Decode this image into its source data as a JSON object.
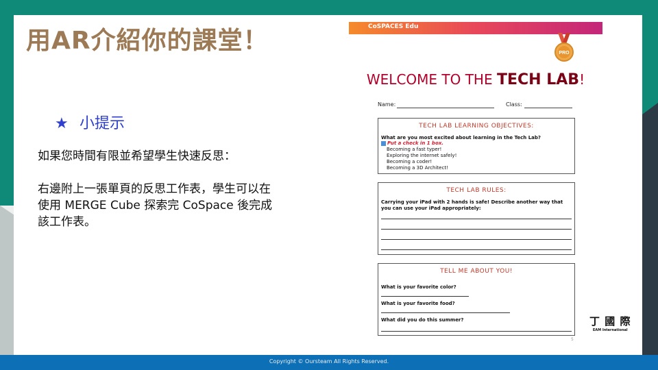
{
  "slide": {
    "title": "用AR介紹你的課堂！",
    "tip_label": "小提示",
    "tip_icon": "star-icon",
    "paragraph1": "如果您時間有限並希望學生快速反思：",
    "paragraph2_line1": "右邊附上一張單頁的反思工作表，學生可以在",
    "paragraph2_line2": "使用 MERGE Cube 探索完 CoSpace 後完成",
    "paragraph2_line3": "該工作表。"
  },
  "worksheet": {
    "logo_text": "CoSPACES Edu",
    "badge_text": "PRO",
    "heading_welcome": "WELCOME TO THE",
    "heading_lab": "TECH LAB",
    "heading_mark": "!",
    "name_label": "Name:",
    "class_label": "Class:",
    "objectives": {
      "title": "TECH LAB LEARNING OBJECTIVES:",
      "question": "What are you most excited about learning in the Tech Lab?",
      "instruction": "Put a check in 1 box.",
      "options": [
        "Becoming a fast typer!",
        "Exploring the internet safely!",
        "Becoming a coder!",
        "Becoming a 3D Architect!"
      ]
    },
    "rules": {
      "title": "TECH LAB RULES:",
      "question": "Carrying your iPad with 2 hands is safe! Describe another way that you can use your iPad appropriately:"
    },
    "about": {
      "title": "TELL ME ABOUT YOU!",
      "q1": "What is your favorite color?",
      "q2": "What is your favorite food?",
      "q3": "What did you do this summer?"
    },
    "page_number": "5"
  },
  "brand": {
    "name_cn": "丁 國 際",
    "name_en": "EAM International"
  },
  "footer": {
    "copyright": "Copyright © Oursteam All Rights Reserved."
  },
  "colors": {
    "title": "#9c7a55",
    "tip": "#2f3fd0",
    "footer": "#0d6fb5",
    "teal_bg": "#0f8a78"
  }
}
